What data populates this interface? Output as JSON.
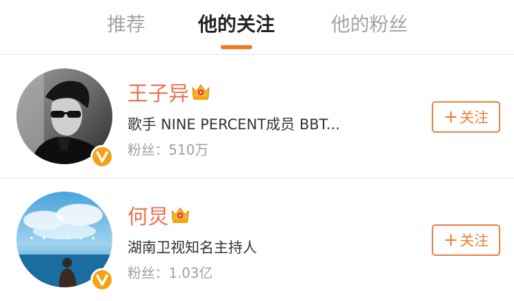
{
  "tabs": [
    {
      "label": "推荐",
      "active": false
    },
    {
      "label": "他的关注",
      "active": true
    },
    {
      "label": "他的粉丝",
      "active": false
    }
  ],
  "accent_color": "#f07a20",
  "users": [
    {
      "name": "王子异",
      "description": "歌手 NINE PERCENT成员 BBT...",
      "fans": "粉丝：510万",
      "verified": true,
      "crown_icon": "crown-icon",
      "follow_label": "关注"
    },
    {
      "name": "何炅",
      "description": "湖南卫视知名主持人",
      "fans": "粉丝：1.03亿",
      "verified": true,
      "crown_icon": "crown-icon",
      "follow_label": "关注"
    }
  ]
}
